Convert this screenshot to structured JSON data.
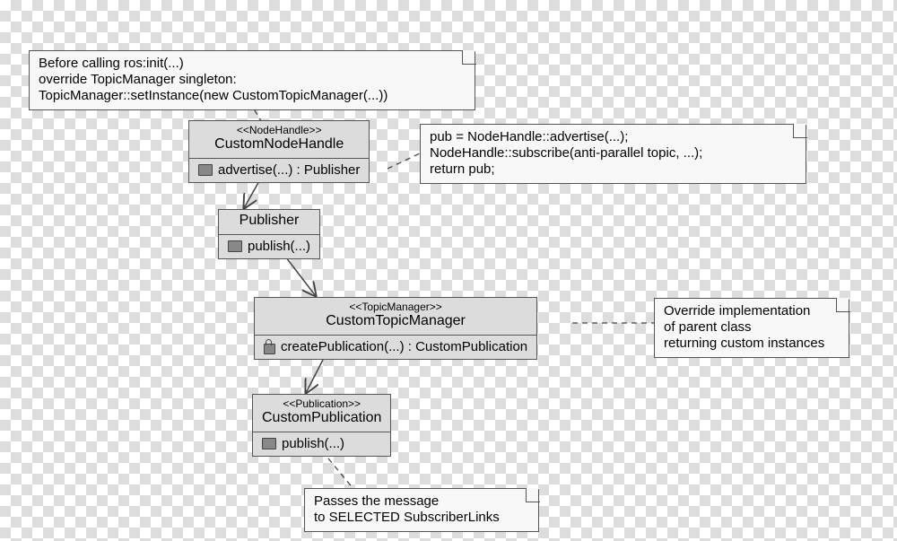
{
  "notes": {
    "n1": {
      "l1": "Before calling ros:init(...)",
      "l2": "override TopicManager singleton:",
      "l3": "TopicManager::setInstance(new CustomTopicManager(...))"
    },
    "n2": {
      "l1": "pub = NodeHandle::advertise(...);",
      "l2": "NodeHandle::subscribe(anti-parallel topic, ...);",
      "l3": "return pub;"
    },
    "n3": {
      "l1": "Override implementation",
      "l2": "of parent class",
      "l3": "returning custom instances"
    },
    "n4": {
      "l1": "Passes the message",
      "l2": "to SELECTED SubscriberLinks"
    }
  },
  "classes": {
    "c1": {
      "stereo": "<<NodeHandle>>",
      "name": "CustomNodeHandle",
      "op1": "advertise(...) : Publisher"
    },
    "c2": {
      "name": "Publisher",
      "op1": "publish(...)"
    },
    "c3": {
      "stereo": "<<TopicManager>>",
      "name": "CustomTopicManager",
      "op1": "createPublication(...) : CustomPublication"
    },
    "c4": {
      "stereo": "<<Publication>>",
      "name": "CustomPublication",
      "op1": "publish(...)"
    }
  }
}
